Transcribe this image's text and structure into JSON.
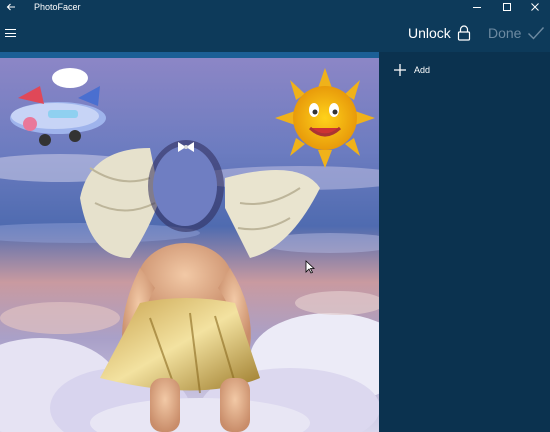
{
  "window": {
    "title": "PhotoFacer",
    "back_icon": "arrow-left-icon",
    "controls": [
      "minimize-icon",
      "maximize-icon",
      "close-icon"
    ]
  },
  "toolbar": {
    "menu_icon": "hamburger-menu-icon",
    "unlock_label": "Unlock",
    "unlock_icon": "lock-icon",
    "done_label": "Done",
    "done_icon": "checkmark-icon"
  },
  "side_panel": {
    "add_label": "Add",
    "add_icon": "plus-icon"
  },
  "colors": {
    "titlebar": "#0d3a5a",
    "accent": "#1c5f96",
    "panel": "#0b324f",
    "done_disabled": "#6d8aa1"
  }
}
